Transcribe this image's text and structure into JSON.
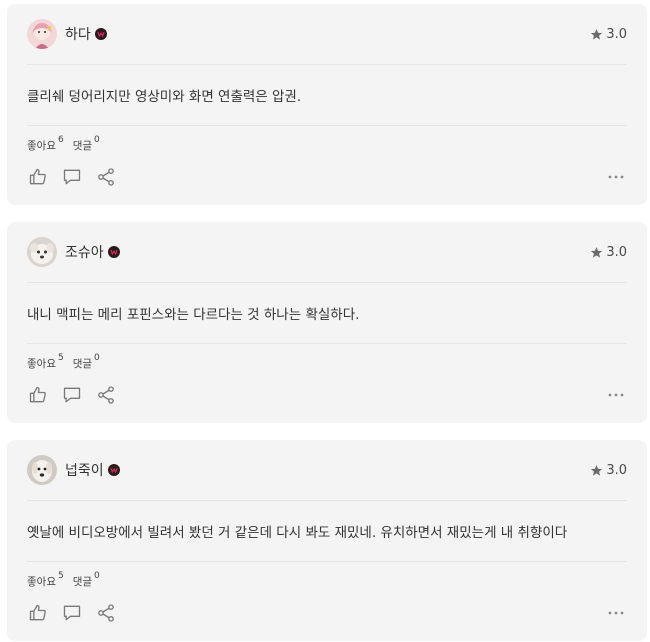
{
  "colors": {
    "card_bg": "#f4f4f4",
    "badge": "#2a1a1a",
    "badge_mark": "#e0245e",
    "icon": "#7a7a7a"
  },
  "comments": [
    {
      "username": "하다",
      "rating": "3.0",
      "text": "클리쉐 덩어리지만 영상미와 화면 연출력은 압권.",
      "likes_label": "좋아요",
      "likes_count": "6",
      "replies_label": "댓글",
      "replies_count": "0",
      "avatar": "avatar-illustration"
    },
    {
      "username": "조슈아",
      "rating": "3.0",
      "text": "내니 맥피는 메리 포핀스와는 다르다는 것 하나는 확실하다.",
      "likes_label": "좋아요",
      "likes_count": "5",
      "replies_label": "댓글",
      "replies_count": "0",
      "avatar": "avatar-puppy"
    },
    {
      "username": "넙죽이",
      "rating": "3.0",
      "text": "옛날에 비디오방에서 빌려서 봤던 거 같은데 다시 봐도 재밌네. 유치하면서 재밌는게 내 취향이다",
      "likes_label": "좋아요",
      "likes_count": "5",
      "replies_label": "댓글",
      "replies_count": "0",
      "avatar": "avatar-dog"
    }
  ],
  "icons": {
    "rating": "star-icon",
    "badge": "watcha-badge-icon",
    "like": "thumbs-up-icon",
    "comment": "comment-icon",
    "share": "share-icon",
    "more": "more-icon"
  }
}
